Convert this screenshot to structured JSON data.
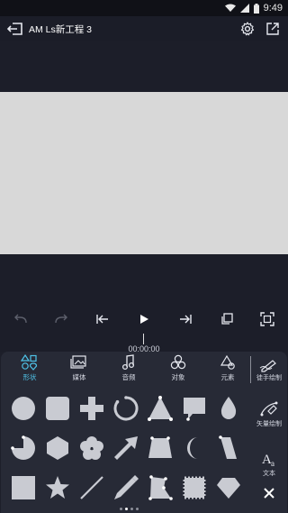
{
  "status_bar": {
    "time": "9:49"
  },
  "header": {
    "title": "AM Ls新工程 3"
  },
  "timeline": {
    "timecode": "00:00:00"
  },
  "tabs": [
    {
      "label": "形状",
      "icon": "shapes-icon",
      "active": true
    },
    {
      "label": "媒体",
      "icon": "media-icon",
      "active": false
    },
    {
      "label": "音频",
      "icon": "audio-icon",
      "active": false
    },
    {
      "label": "对象",
      "icon": "objects-icon",
      "active": false
    },
    {
      "label": "元素",
      "icon": "elements-icon",
      "active": false
    }
  ],
  "side_tools": {
    "freehand": "徒手绘制",
    "vector": "矢量绘制",
    "text": "文本"
  },
  "shapes": [
    "circle",
    "rounded-square",
    "plus",
    "ring",
    "triangle",
    "speech-bubble",
    "drop",
    "pie",
    "hexagon",
    "flower",
    "arrow",
    "trapezoid",
    "crescent",
    "parallelogram",
    "square",
    "star",
    "line",
    "pencil",
    "polygon",
    "stamp",
    "diamond-gem"
  ],
  "colors": {
    "accent": "#4fc3e8",
    "shape_fill": "#c9cbd2",
    "panel": "#272a36",
    "background": "#1c1e29"
  }
}
